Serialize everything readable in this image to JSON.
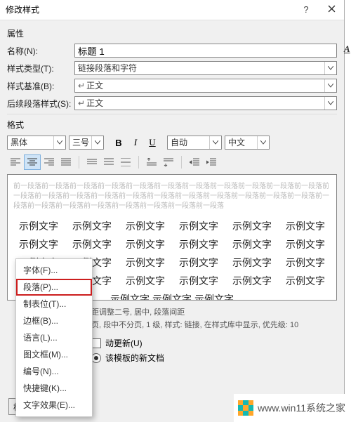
{
  "titlebar": {
    "title": "修改样式",
    "help": "?",
    "close_aria": "关闭"
  },
  "section_props": "属性",
  "rows": {
    "name_label": "名称(N):",
    "name_value": "标题 1",
    "type_label": "样式类型(T):",
    "type_value": "链接段落和字符",
    "based_label": "样式基准(B):",
    "based_value": "正文",
    "follow_label": "后续段落样式(S):",
    "follow_value": "正文"
  },
  "section_format": "格式",
  "format": {
    "font": "黑体",
    "size": "三号",
    "b": "B",
    "i": "I",
    "u": "U",
    "color": "自动",
    "lang": "中文"
  },
  "preview": {
    "lorem_unit": "前一段落",
    "sample_unit": "示例文字"
  },
  "desc": {
    "line1_tail": "距调整二号, 居中, 段落间距",
    "line2_tail": "页, 段中不分页, 1 级, 样式: 链接, 在样式库中显示, 优先级: 10"
  },
  "opts": {
    "auto_update_tail": "动更新(U)",
    "radio1_tail": "该模板的新文档"
  },
  "format_btn": "格式(O)",
  "menu": {
    "font": "字体(F)...",
    "para": "段落(P)...",
    "tabs": "制表位(T)...",
    "border": "边框(B)...",
    "lang": "语言(L)...",
    "frame": "图文框(M)...",
    "number": "编号(N)...",
    "shortcut": "快捷键(K)...",
    "texteffect": "文字效果(E)..."
  },
  "edge": {
    "a": "A"
  },
  "watermark": {
    "url": "www.win11系统之家"
  },
  "chart_data": null
}
